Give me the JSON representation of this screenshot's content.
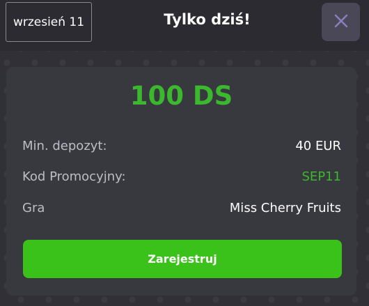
{
  "header": {
    "date_label": "wrzesień 11",
    "title": "Tylko dziś!",
    "close_icon": "close-icon"
  },
  "offer": {
    "amount": "100 DS",
    "rows": [
      {
        "label": "Min. depozyt:",
        "value": "40 EUR"
      },
      {
        "label": "Kod Promocyjny:",
        "value": "SEP11"
      },
      {
        "label": "Gra",
        "value": "Miss Cherry Fruits"
      }
    ],
    "register_label": "Zarejestruj"
  },
  "colors": {
    "accent_green": "#3bc21a",
    "amount_green": "#3cb82f",
    "card_bg": "#38383f",
    "header_bg": "#2b2b31",
    "close_btn_bg": "#4a4856",
    "close_icon_color": "#8b7fc0"
  }
}
